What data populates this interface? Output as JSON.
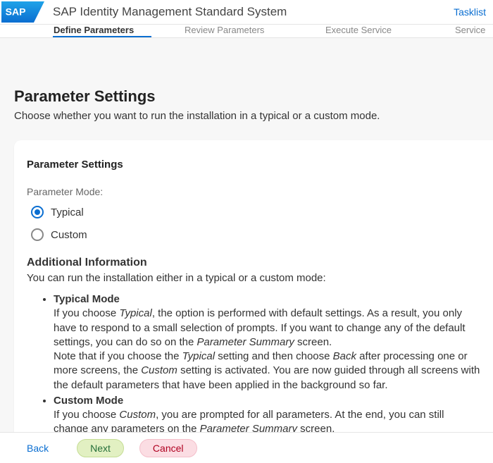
{
  "header": {
    "app_title": "SAP Identity Management Standard System",
    "tasklist_label": "Tasklist"
  },
  "wizard": {
    "steps": [
      {
        "label": "Define Parameters",
        "active": true
      },
      {
        "label": "Review Parameters",
        "active": false
      },
      {
        "label": "Execute Service",
        "active": false
      },
      {
        "label": "Service",
        "active": false
      }
    ]
  },
  "page": {
    "title": "Parameter Settings",
    "subtitle": "Choose whether you want to run the installation in a typical or a custom mode."
  },
  "card": {
    "section_title": "Parameter Settings",
    "mode_label": "Parameter Mode:",
    "options": {
      "typical": "Typical",
      "custom": "Custom"
    },
    "selected": "typical",
    "addl_title": "Additional Information",
    "addl_intro": "You can run the installation either in a typical or a custom mode:",
    "typical_heading": "Typical Mode",
    "typical_text_parts": {
      "a": "If you choose ",
      "b": "Typical",
      "c": ", the option is performed with default settings. As a result, you only have to respond to a small selection of prompts. If you want to change any of the default settings, you can do so on the ",
      "d": "Parameter Summary",
      "e": " screen.",
      "f": "Note that if you choose the ",
      "g": "Typical",
      "h": " setting and then choose ",
      "i": "Back",
      "j": " after processing one or more screens, the ",
      "k": "Custom",
      "l": " setting is activated. You are now guided through all screens with the default parameters that have been applied in the background so far."
    },
    "custom_heading": "Custom Mode",
    "custom_text_parts": {
      "a": "If you choose ",
      "b": "Custom",
      "c": ", you are prompted for all parameters. At the end, you can still change any parameters on the ",
      "d": "Parameter Summary",
      "e": " screen."
    }
  },
  "footer": {
    "back": "Back",
    "next": "Next",
    "cancel": "Cancel"
  }
}
